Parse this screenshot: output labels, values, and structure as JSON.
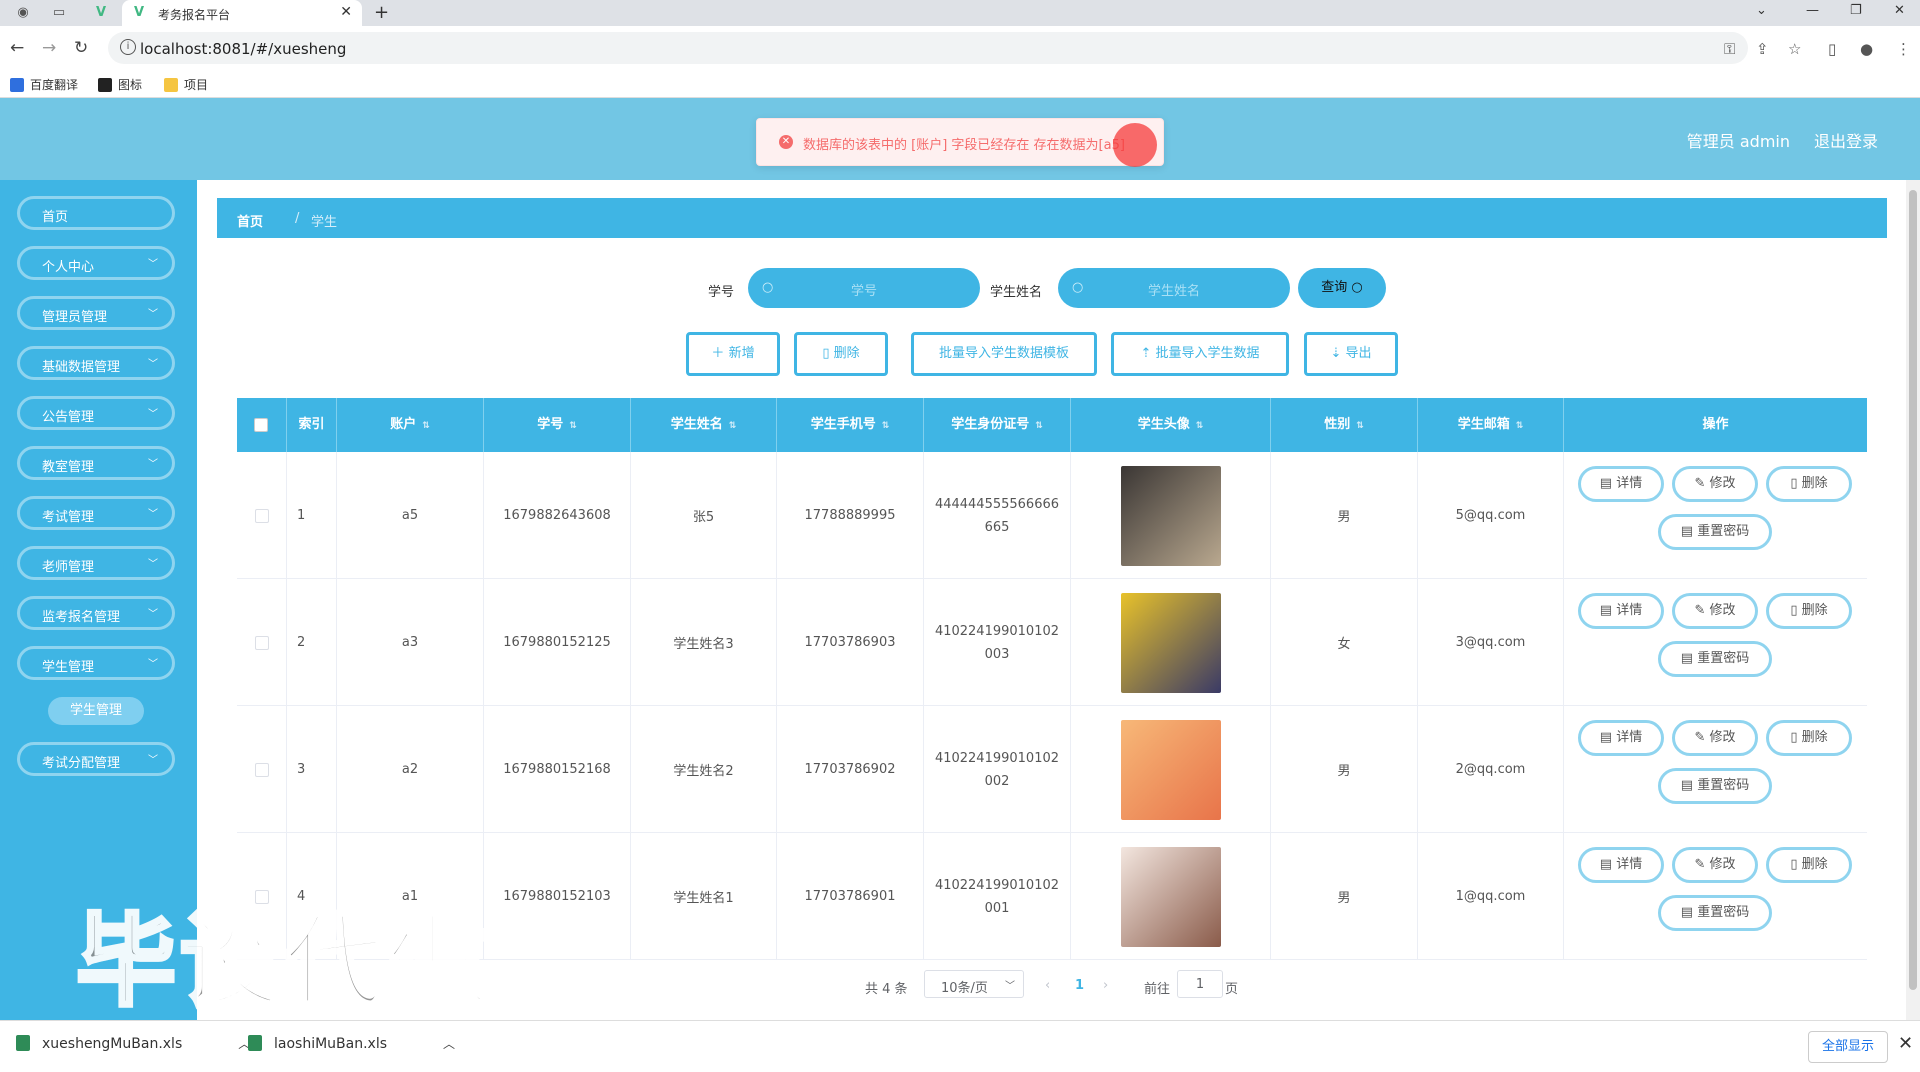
{
  "browser": {
    "tab_title": "考务报名平台",
    "url": "localhost:8081/#/xuesheng",
    "bookmarks": [
      "百度翻译",
      "图标",
      "项目"
    ]
  },
  "header": {
    "user_label": "管理员 admin",
    "logout_label": "退出登录"
  },
  "toast": {
    "message": "数据库的该表中的 [账户] 字段已经存在 存在数据为[a5]"
  },
  "sidebar": {
    "items": [
      {
        "label": "首页",
        "has_children": false
      },
      {
        "label": "个人中心",
        "has_children": true
      },
      {
        "label": "管理员管理",
        "has_children": true
      },
      {
        "label": "基础数据管理",
        "has_children": true
      },
      {
        "label": "公告管理",
        "has_children": true
      },
      {
        "label": "教室管理",
        "has_children": true
      },
      {
        "label": "考试管理",
        "has_children": true
      },
      {
        "label": "老师管理",
        "has_children": true
      },
      {
        "label": "监考报名管理",
        "has_children": true
      },
      {
        "label": "学生管理",
        "has_children": true
      },
      {
        "label": "考试分配管理",
        "has_children": true
      }
    ],
    "active_submenu": "学生管理"
  },
  "breadcrumb": {
    "home": "首页",
    "current": "学生"
  },
  "search": {
    "id_label": "学号",
    "id_placeholder": "学号",
    "name_label": "学生姓名",
    "name_placeholder": "学生姓名",
    "query_label": "查询"
  },
  "actions": {
    "add": "新增",
    "delete": "删除",
    "template": "批量导入学生数据模板",
    "import": "批量导入学生数据",
    "export": "导出"
  },
  "table": {
    "columns": [
      "索引",
      "账户",
      "学号",
      "学生姓名",
      "学生手机号",
      "学生身份证号",
      "学生头像",
      "性别",
      "学生邮箱",
      "操作"
    ],
    "rows": [
      {
        "index": "1",
        "account": "a5",
        "student_no": "1679882643608",
        "name": "张5",
        "phone": "17788889995",
        "id_card_1": "444444555566666",
        "id_card_2": "665",
        "gender": "男",
        "email": "5@qq.com",
        "avatar_colors": [
          "#3a3634",
          "#b9a88f"
        ]
      },
      {
        "index": "2",
        "account": "a3",
        "student_no": "1679880152125",
        "name": "学生姓名3",
        "phone": "17703786903",
        "id_card_1": "410224199010102",
        "id_card_2": "003",
        "gender": "女",
        "email": "3@qq.com",
        "avatar_colors": [
          "#e8c22a",
          "#3a3a66"
        ]
      },
      {
        "index": "3",
        "account": "a2",
        "student_no": "1679880152168",
        "name": "学生姓名2",
        "phone": "17703786902",
        "id_card_1": "410224199010102",
        "id_card_2": "002",
        "gender": "男",
        "email": "2@qq.com",
        "avatar_colors": [
          "#f7b878",
          "#e8744a"
        ]
      },
      {
        "index": "4",
        "account": "a1",
        "student_no": "1679880152103",
        "name": "学生姓名1",
        "phone": "17703786901",
        "id_card_1": "410224199010102",
        "id_card_2": "001",
        "gender": "男",
        "email": "1@qq.com",
        "avatar_colors": [
          "#f3e6df",
          "#8a5b4a"
        ]
      }
    ],
    "op_labels": {
      "detail": "详情",
      "edit": "修改",
      "delete": "删除",
      "reset": "重置密码"
    }
  },
  "pagination": {
    "total": "共 4 条",
    "page_size": "10条/页",
    "current_page": "1",
    "goto_label": "前往",
    "goto_value": "1",
    "page_suffix": "页"
  },
  "watermark": "毕设代做",
  "downloads": {
    "files": [
      "xueshengMuBan.xls",
      "laoshiMuBan.xls"
    ],
    "show_all": "全部显示"
  },
  "colors": {
    "primary": "#3fb5e4",
    "header": "#72c6e4",
    "error": "#f56c6c"
  }
}
